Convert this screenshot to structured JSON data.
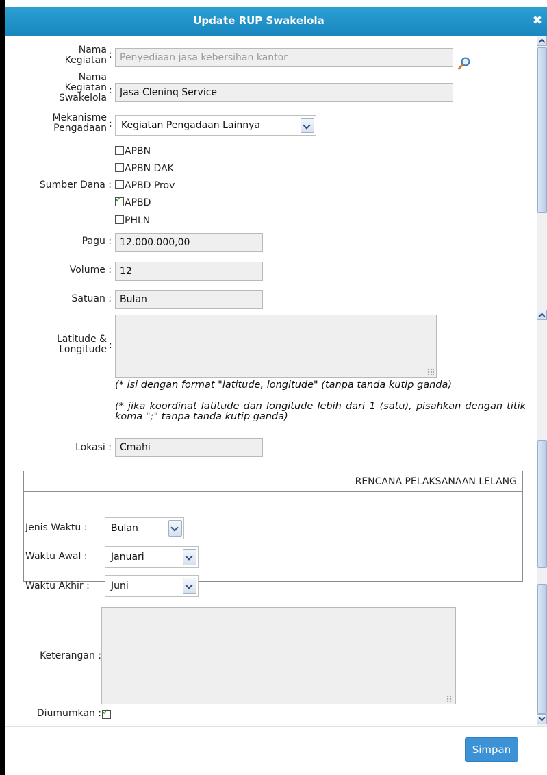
{
  "dialog": {
    "title": "Update RUP Swakelola",
    "close_label": "✖"
  },
  "form": {
    "nama_kegiatan": {
      "label1": "Nama",
      "label2": "Kegiatan",
      "value": "Penyediaan jasa kebersihan kantor"
    },
    "nama_kegiatan_swakelola": {
      "label1": "Nama",
      "label2": "Kegiatan",
      "label3": "Swakelola",
      "value": "Jasa Cleninq Service"
    },
    "mekanisme": {
      "label1": "Mekanisme",
      "label2": "Pengadaan",
      "value": "Kegiatan Pengadaan Lainnya"
    },
    "sumber_dana": {
      "label": "Sumber Dana",
      "options": [
        {
          "label": "APBN",
          "checked": false
        },
        {
          "label": "APBN DAK",
          "checked": false
        },
        {
          "label": "APBD Prov",
          "checked": false
        },
        {
          "label": "APBD",
          "checked": true
        },
        {
          "label": "PHLN",
          "checked": false
        }
      ]
    },
    "pagu": {
      "label": "Pagu",
      "value": "12.000.000,00"
    },
    "volume": {
      "label": "Volume",
      "value": "12"
    },
    "satuan": {
      "label": "Satuan",
      "value": "Bulan"
    },
    "latlong": {
      "label1": "Latitude &",
      "label2": "Longitude",
      "value": ""
    },
    "notes": {
      "line1": "(* isi dengan format \"latitude, longitude\" (tanpa tanda kutip ganda)",
      "line2": "(* jika koordinat latitude dan longitude lebih dari 1 (satu), pisahkan dengan titik koma \";\" tanpa tanda kutip ganda)"
    },
    "lokasi": {
      "label": "Lokasi",
      "value": "Cmahi"
    },
    "rencana": {
      "title": "RENCANA PELAKSANAAN LELANG",
      "jenis_waktu": {
        "label": "Jenis Waktu",
        "value": "Bulan"
      },
      "waktu_awal": {
        "label": "Waktu Awal",
        "value": "Januari"
      },
      "waktu_akhir": {
        "label": "Waktu Akhir",
        "value": "Juni"
      }
    },
    "keterangan": {
      "label": "Keterangan",
      "value": ""
    },
    "diumumkan": {
      "label": "Diumumkan",
      "checked": true
    }
  },
  "footer": {
    "save_label": "Simpan"
  },
  "colors": {
    "titlebar": "#1987c0",
    "save_button": "#3d92d5",
    "check": "#1b9a1b"
  },
  "icons": {
    "search": "search-icon",
    "close": "close-icon"
  }
}
